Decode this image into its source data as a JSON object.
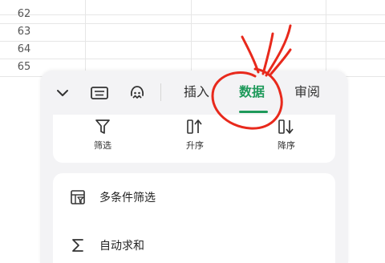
{
  "sheet": {
    "rows": [
      "62",
      "63",
      "64",
      "65"
    ]
  },
  "toolbar": {
    "tabs": [
      {
        "label": "插入",
        "active": false
      },
      {
        "label": "数据",
        "active": true
      },
      {
        "label": "审阅",
        "active": false
      }
    ],
    "icons": [
      "chevron-down-icon",
      "keyboard-icon",
      "ai-assistant-icon"
    ]
  },
  "tools": [
    {
      "label": "筛选",
      "icon": "filter-icon"
    },
    {
      "label": "升序",
      "icon": "sort-ascending-icon"
    },
    {
      "label": "降序",
      "icon": "sort-descending-icon"
    }
  ],
  "menu": [
    {
      "label": "多条件筛选",
      "icon": "multi-filter-icon"
    },
    {
      "label": "自动求和",
      "icon": "sigma-icon"
    }
  ],
  "colors": {
    "accent": "#1f9a5b",
    "annotation": "#e8291c"
  }
}
